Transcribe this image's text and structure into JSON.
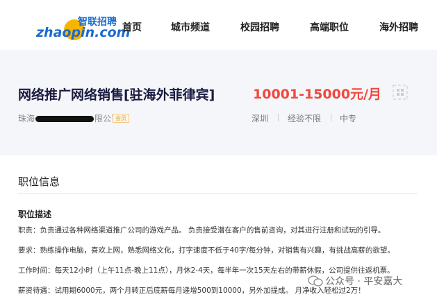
{
  "logo": {
    "cn": "智联招聘",
    "en": "zhaopin.com"
  },
  "nav": {
    "items": [
      {
        "label": "首页"
      },
      {
        "label": "城市频道"
      },
      {
        "label": "校园招聘"
      },
      {
        "label": "高端职位"
      },
      {
        "label": "海外招聘"
      }
    ]
  },
  "job": {
    "title": "网络推广网络销售[驻海外菲律宾]",
    "salary": "10001-15000元/月",
    "company_prefix": "珠海",
    "company_suffix": "限公司",
    "member_badge": "会员",
    "city": "深圳",
    "experience": "经验不限",
    "education": "中专"
  },
  "info": {
    "section_title": "职位信息",
    "desc_heading": "职位描述",
    "lines": [
      "职责：负责通过各种网络渠道推广公司的游戏产品。 负责接受潜在客户的售前咨询，对其进行注册和试玩的引导。",
      "要求：熟练操作电脑，喜欢上网，熟悉网络文化，打字速度不低于40字/每分钟，对销售有兴趣，有挑战高薪的欲望。",
      "工作时间：每天12小时（上午11点-晚上11点），月休2-4天，每半年一次15天左右的带薪休假，公司提供往返机票。",
      "薪资待遇：试用期6000元，两个月转正后底薪每月递增500到10000，另外加提成。 月净收入轻松过2万！"
    ]
  },
  "watermark": {
    "text": "公众号 · 平安嘉大"
  },
  "colors": {
    "brand_blue": "#1b6bcf",
    "logo_yellow": "#f7b500",
    "salary_red": "#f0483e",
    "header_bg": "#f4f6f9"
  }
}
